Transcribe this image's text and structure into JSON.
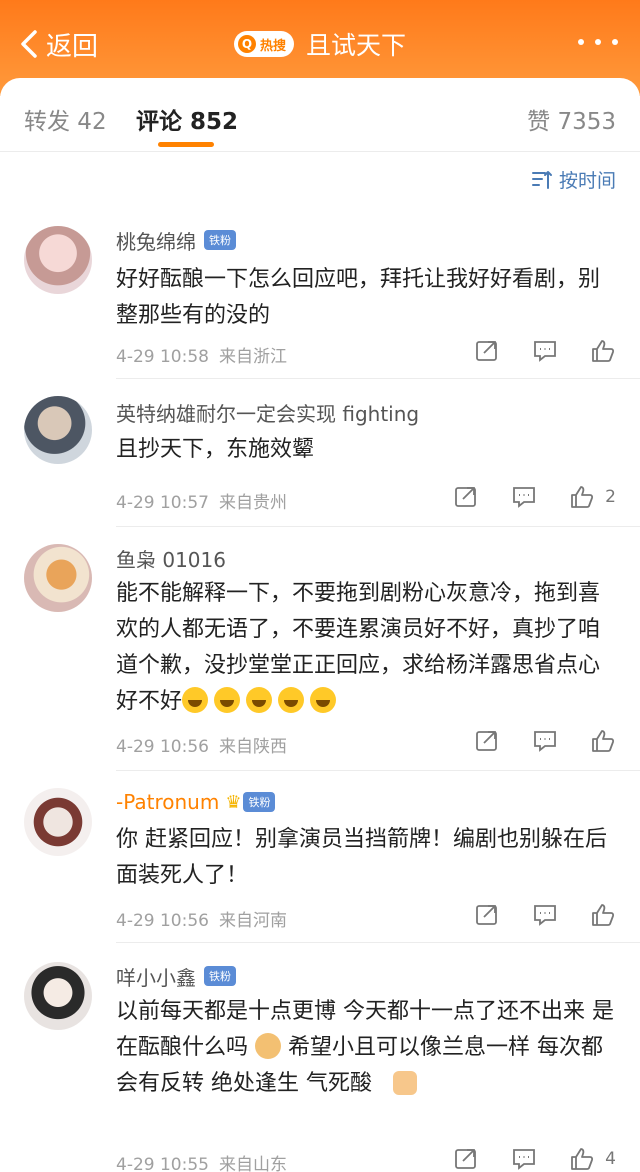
{
  "header": {
    "back_label": "返回",
    "hot_badge": "热搜",
    "title": "且试天下"
  },
  "tabs": {
    "forward": "转发 42",
    "comment": "评论 852",
    "like": "赞 7353"
  },
  "sort_label": "按时间",
  "comments": [
    {
      "name": "桃兔绵绵",
      "badge": "铁粉",
      "text": "好好酝酿一下怎么回应吧，拜托让我好好看剧，别整那些有的没的",
      "time": "4-29 10:58",
      "loc": "来自浙江",
      "likes": ""
    },
    {
      "name": "英特纳雄耐尔一定会实现 fighting",
      "badge": "",
      "text": "且抄天下，东施效颦",
      "time": "4-29 10:57",
      "loc": "来自贵州",
      "likes": "2"
    },
    {
      "name": "鱼枭 01016",
      "badge": "",
      "text": "能不能解释一下，不要拖到剧粉心灰意冷，拖到喜欢的人都无语了，不要连累演员好不好，真抄了咱道个歉，没抄堂堂正正回应，求给杨洋露思省点心好不好",
      "time": "4-29 10:56",
      "loc": "来自陕西",
      "likes": ""
    },
    {
      "name": "-Patronum",
      "badge": "铁粉",
      "text": "你 赶紧回应！别拿演员当挡箭牌！编剧也别躲在后面装死人了！",
      "time": "4-29 10:56",
      "loc": "来自河南",
      "likes": ""
    },
    {
      "name": "咩小小鑫",
      "badge": "铁粉",
      "text1": "以前每天都是十点更博 今天都十一点了还不出来 是在酝酿什么吗",
      "text2": " 希望小且可以像兰息一样 每次都会有反转 绝处逢生 气死酸",
      "time": "4-29 10:55",
      "loc": "来自山东",
      "likes": "4"
    }
  ]
}
